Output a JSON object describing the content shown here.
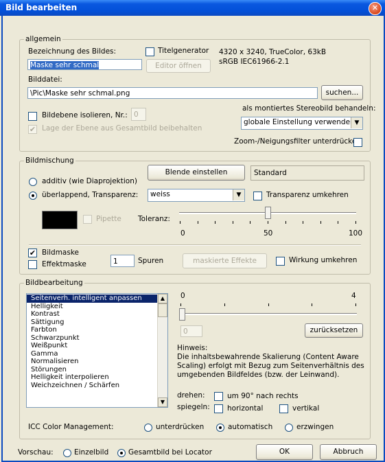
{
  "window": {
    "title": "Bild bearbeiten"
  },
  "allgemein": {
    "legend": "allgemein",
    "name_label": "Bezeichnung des Bildes:",
    "name_value": "Maske sehr schmal",
    "titelgenerator_label": "Titelgenerator",
    "titelgenerator_checked": false,
    "editor_button": "Editor öffnen",
    "info_line1": "4320 x 3240, TrueColor, 63kB",
    "info_line2": "sRGB IEC61966-2.1",
    "file_label": "Bilddatei:",
    "file_value": "\\Pic\\Maske sehr schmal.png",
    "search_button": "suchen...",
    "isolate_label": "Bildebene isolieren, Nr.:",
    "isolate_checked": false,
    "isolate_value": "0",
    "keep_pos_label": "Lage der Ebene aus Gesamtbild beibehalten",
    "keep_pos_checked": true,
    "stereo_label": "als montiertes Stereobild behandeln:",
    "stereo_value": "globale Einstellung verwenden",
    "zoom_label": "Zoom-/Neigungsfilter unterdrücken",
    "zoom_checked": false
  },
  "bildmischung": {
    "legend": "Bildmischung",
    "blende_button": "Blende einstellen",
    "blende_value": "Standard",
    "additiv_label": "additiv (wie Diaprojektion)",
    "ueberlappend_label": "überlappend, Transparenz:",
    "mode": "ueberlappend",
    "transparency_value": "weiss",
    "invert_transparency_label": "Transparenz umkehren",
    "invert_transparency_checked": false,
    "pipette_label": "Pipette",
    "swatch_color": "#000000",
    "tolerance_label": "Toleranz:",
    "tolerance_value": 50,
    "tolerance_min_label": "0",
    "tolerance_mid_label": "50",
    "tolerance_max_label": "100",
    "bildmaske_label": "Bildmaske",
    "bildmaske_checked": true,
    "effektmaske_label": "Effektmaske",
    "effektmaske_checked": false,
    "spuren_value": "1",
    "spuren_label": "Spuren",
    "masked_effects_button": "maskierte Effekte",
    "wirkung_label": "Wirkung umkehren",
    "wirkung_checked": false
  },
  "bildbearbeitung": {
    "legend": "Bildbearbeitung",
    "items": [
      "Seitenverh. intelligent anpassen",
      "Helligkeit",
      "Kontrast",
      "Sättigung",
      "Farbton",
      "Schwarzpunkt",
      "Weißpunkt",
      "Gamma",
      "Normalisieren",
      "Störungen",
      "Helligkeit interpolieren",
      "Weichzeichnen / Schärfen"
    ],
    "selected_index": 0,
    "slider_min_label": "0",
    "slider_max_label": "4",
    "slider_value": "0",
    "reset_button": "zurücksetzen",
    "hint_title": "Hinweis:",
    "hint_text_1": "Die inhaltsbewahrende Skalierung (Content Aware",
    "hint_text_2": "Scaling) erfolgt mit Bezug zum Seitenverhältnis des",
    "hint_text_3": "umgebenden Bildfeldes (bzw. der Leinwand).",
    "drehen_label": "drehen:",
    "rotate_label": "um 90° nach rechts",
    "rotate_checked": false,
    "spiegeln_label": "spiegeln:",
    "horizontal_label": "horizontal",
    "horizontal_checked": false,
    "vertikal_label": "vertikal",
    "vertikal_checked": false,
    "icc_label": "ICC Color Management:",
    "icc_options": [
      "unterdrücken",
      "automatisch",
      "erzwingen"
    ],
    "icc_selected": "automatisch"
  },
  "footer": {
    "preview_label": "Vorschau:",
    "einzelbild_label": "Einzelbild",
    "gesamtbild_label": "Gesamtbild bei Locator",
    "preview_selected": "gesamtbild",
    "ok_button": "OK",
    "cancel_button": "Abbruch"
  }
}
